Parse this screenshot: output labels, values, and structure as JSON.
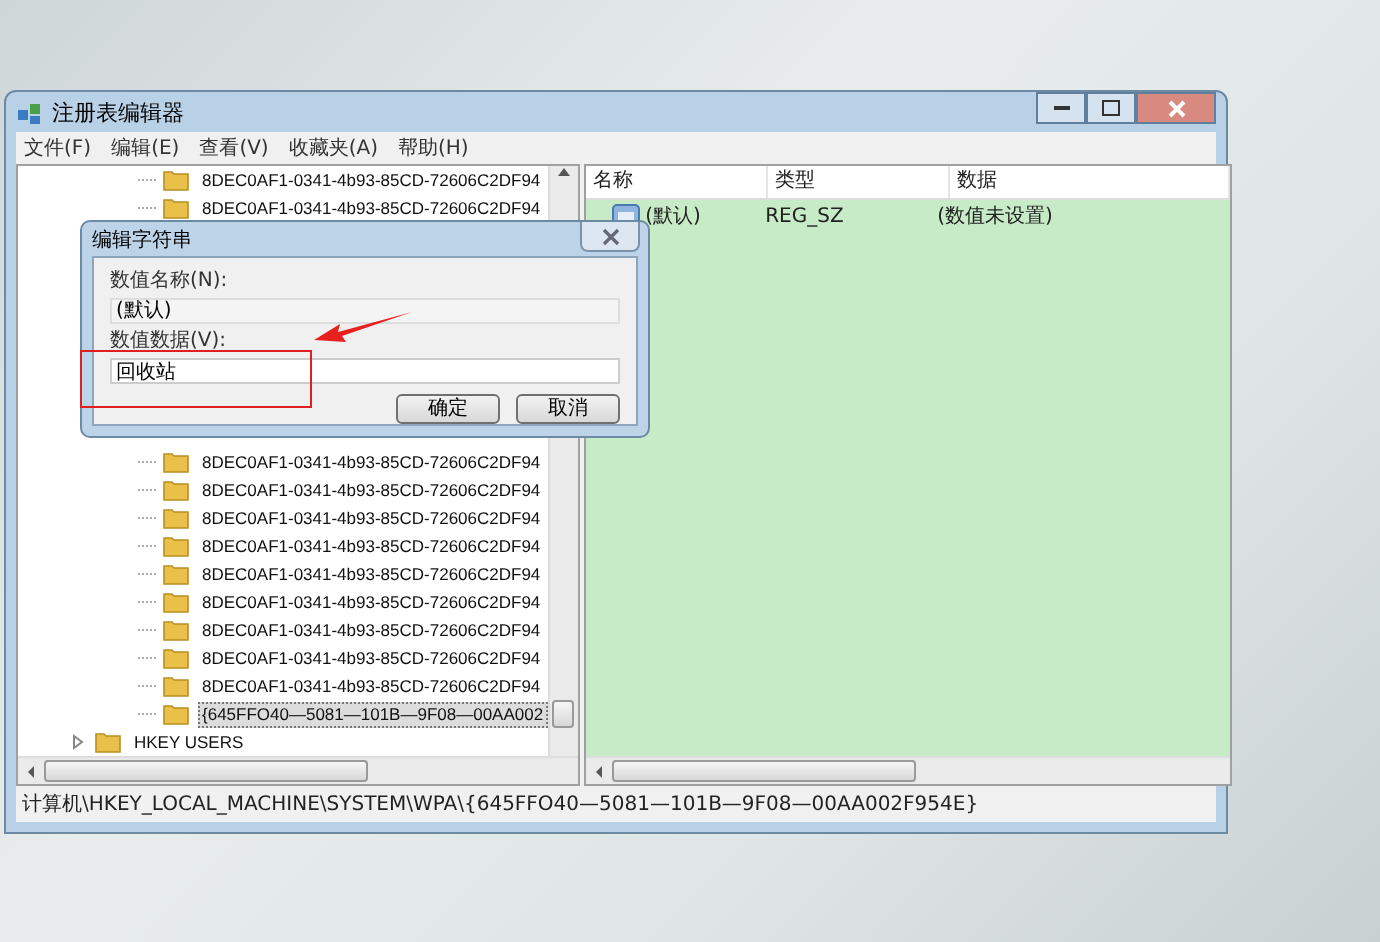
{
  "window": {
    "title": "注册表编辑器"
  },
  "menu": [
    "文件(F)",
    "编辑(E)",
    "查看(V)",
    "收藏夹(A)",
    "帮助(H)"
  ],
  "tree": {
    "items_above": [
      "8DEC0AF1-0341-4b93-85CD-72606C2DF94",
      "8DEC0AF1-0341-4b93-85CD-72606C2DF94"
    ],
    "items_below": [
      {
        "label": "8DEC0AF1-0341-4b93-85CD-72606C2DF94",
        "selected": false
      },
      {
        "label": "8DEC0AF1-0341-4b93-85CD-72606C2DF94",
        "selected": false
      },
      {
        "label": "8DEC0AF1-0341-4b93-85CD-72606C2DF94",
        "selected": false
      },
      {
        "label": "8DEC0AF1-0341-4b93-85CD-72606C2DF94",
        "selected": false
      },
      {
        "label": "8DEC0AF1-0341-4b93-85CD-72606C2DF94",
        "selected": false
      },
      {
        "label": "8DEC0AF1-0341-4b93-85CD-72606C2DF94",
        "selected": false
      },
      {
        "label": "8DEC0AF1-0341-4b93-85CD-72606C2DF94",
        "selected": false
      },
      {
        "label": "8DEC0AF1-0341-4b93-85CD-72606C2DF94",
        "selected": false
      },
      {
        "label": "8DEC0AF1-0341-4b93-85CD-72606C2DF94",
        "selected": false
      },
      {
        "label": "{645FFO40—5081—101B—9F08—00AA002",
        "selected": true
      }
    ],
    "root": {
      "label": "HKEY USERS",
      "expanded": false
    }
  },
  "list": {
    "columns": [
      "名称",
      "类型",
      "数据"
    ],
    "rows": [
      {
        "name": "(默认)",
        "type": "REG_SZ",
        "data": "(数值未设置)"
      }
    ]
  },
  "status_bar": "计算机\\HKEY_LOCAL_MACHINE\\SYSTEM\\WPA\\{645FFO40—5081—101B—9F08—00AA002F954E}",
  "dialog": {
    "title": "编辑字符串",
    "name_label": "数值名称(N):",
    "name_value": "(默认)",
    "data_label": "数值数据(V):",
    "data_value": "回收站",
    "buttons": [
      "确定",
      "取消"
    ]
  }
}
